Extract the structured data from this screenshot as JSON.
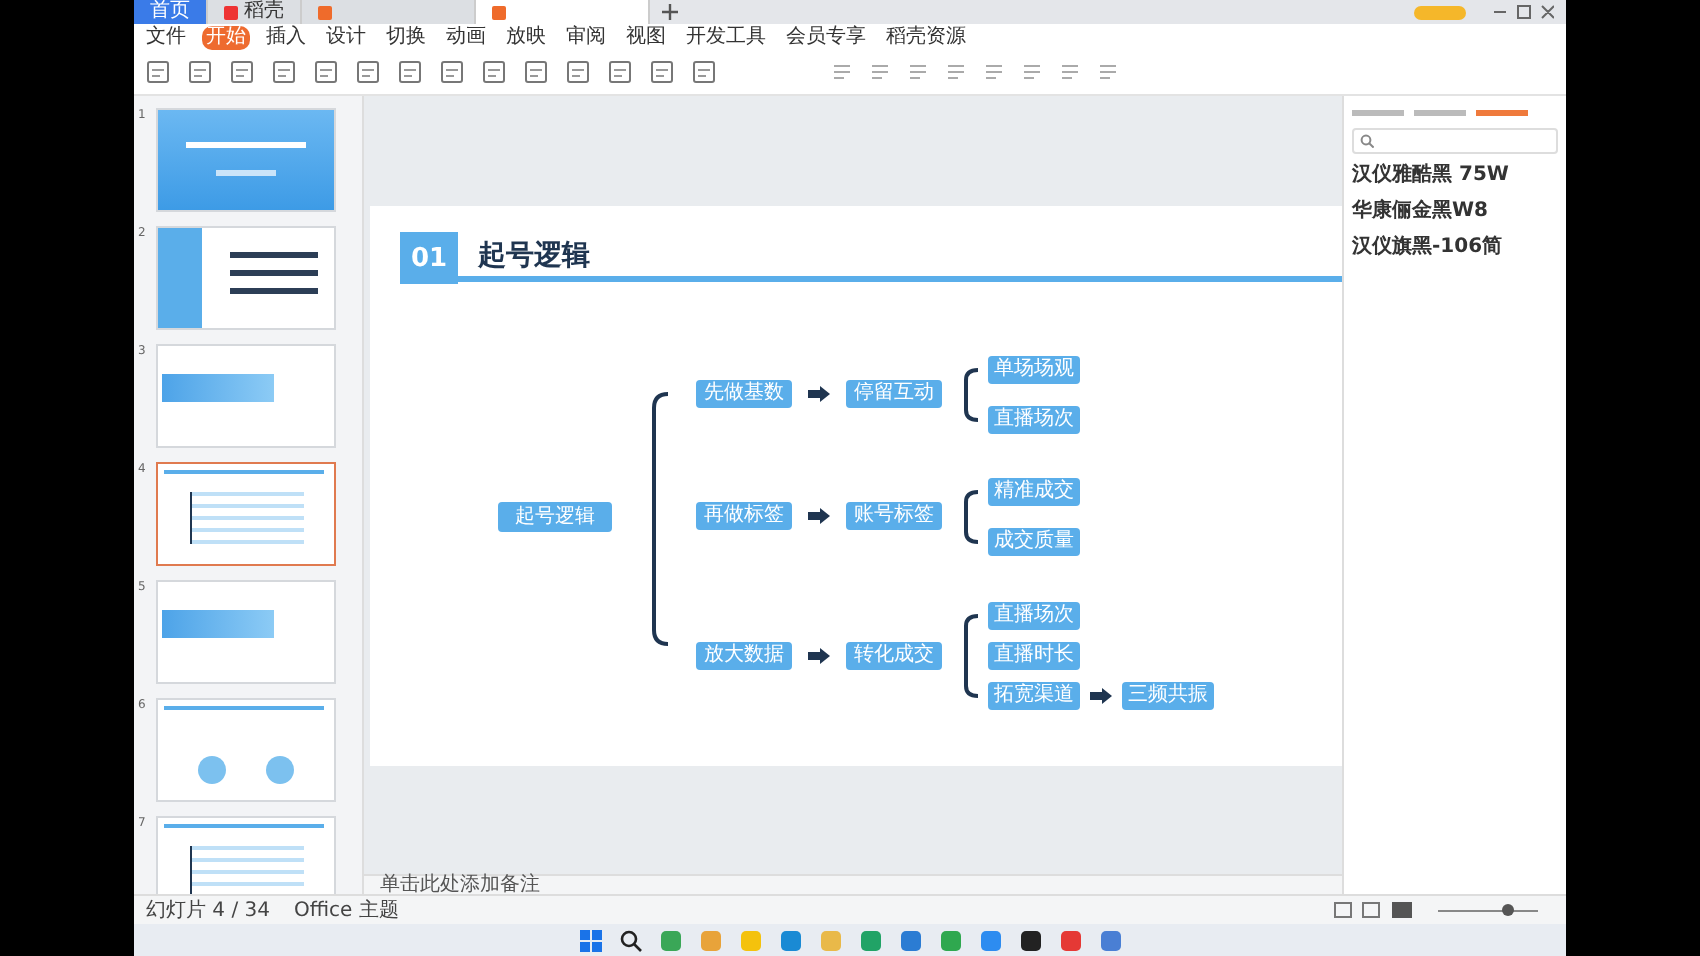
{
  "title_bar": {
    "tabs": [
      {
        "label": "首页",
        "kind": "home",
        "selected": false
      },
      {
        "label": "稻壳",
        "kind": "shell",
        "selected": false
      },
      {
        "kind": "doc",
        "selected": false
      },
      {
        "kind": "doc",
        "selected": true
      }
    ]
  },
  "menu": [
    {
      "label": "文件",
      "selected": false
    },
    {
      "label": "开始",
      "selected": true
    },
    {
      "label": "插入",
      "selected": false
    },
    {
      "label": "设计",
      "selected": false
    },
    {
      "label": "切换",
      "selected": false
    },
    {
      "label": "动画",
      "selected": false
    },
    {
      "label": "放映",
      "selected": false
    },
    {
      "label": "审阅",
      "selected": false
    },
    {
      "label": "视图",
      "selected": false
    },
    {
      "label": "开发工具",
      "selected": false
    },
    {
      "label": "会员专享",
      "selected": false
    },
    {
      "label": "稻壳资源",
      "selected": false
    }
  ],
  "thumbnails": [
    {
      "number": "1",
      "kind": "cover",
      "selected": false
    },
    {
      "number": "2",
      "kind": "toc",
      "selected": false
    },
    {
      "number": "3",
      "kind": "section",
      "selected": false
    },
    {
      "number": "4",
      "kind": "mindmap",
      "selected": true
    },
    {
      "number": "5",
      "kind": "section",
      "selected": false
    },
    {
      "number": "6",
      "kind": "circles",
      "selected": false
    },
    {
      "number": "7",
      "kind": "list",
      "selected": false
    }
  ],
  "slide": {
    "header": {
      "number": "01",
      "title": "起号逻辑"
    },
    "mindmap": {
      "root": "起号逻辑",
      "branches": [
        {
          "label": "先做基数",
          "next": "停留互动",
          "leaves": [
            {
              "label": "单场场观"
            },
            {
              "label": "直播场次"
            }
          ]
        },
        {
          "label": "再做标签",
          "next": "账号标签",
          "leaves": [
            {
              "label": "精准成交"
            },
            {
              "label": "成交质量"
            }
          ]
        },
        {
          "label": "放大数据",
          "next": "转化成交",
          "leaves": [
            {
              "label": "直播场次"
            },
            {
              "label": "直播时长"
            },
            {
              "label": "拓宽渠道",
              "next": "三频共振"
            }
          ]
        }
      ]
    }
  },
  "font_panel": {
    "tabs": [
      {
        "selected": false
      },
      {
        "selected": false
      },
      {
        "selected": true
      }
    ],
    "fonts": [
      "汉仪雅酷黑 75W",
      "华康俪金黑W8",
      "汉仪旗黑-106简"
    ]
  },
  "notes": {
    "placeholder": "单击此处添加备注"
  },
  "status_bar": {
    "slide": "幻灯片 4 / 34",
    "theme": "Office 主题",
    "zoom": {
      "level": 0.7
    }
  }
}
